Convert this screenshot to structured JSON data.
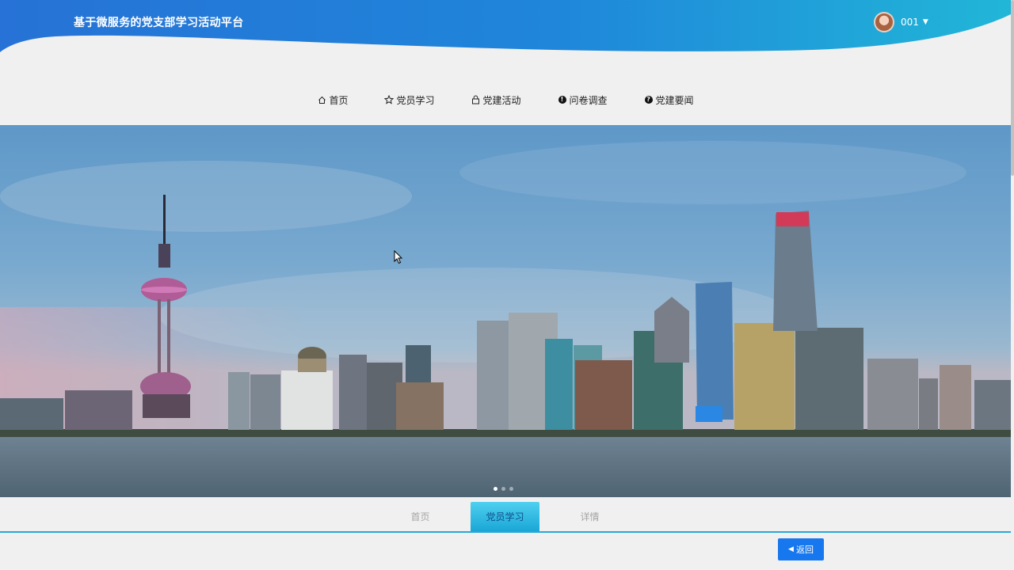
{
  "header": {
    "site_title": "基于微服务的党支部学习活动平台",
    "username": "001",
    "gradient_start": "#2672d6",
    "gradient_end": "#21b6d8"
  },
  "nav": {
    "items": [
      {
        "label": "首页",
        "icon": "home-icon"
      },
      {
        "label": "党员学习",
        "icon": "star-icon"
      },
      {
        "label": "党建活动",
        "icon": "lock-icon"
      },
      {
        "label": "问卷调查",
        "icon": "exclamation-circle-icon"
      },
      {
        "label": "党建要闻",
        "icon": "question-circle-icon"
      }
    ]
  },
  "banner": {
    "slide_count": 3,
    "active_slide": 1
  },
  "tabs": {
    "items": [
      "首页",
      "党员学习",
      "详情"
    ],
    "active_index": 1
  },
  "actions": {
    "back_label": "返回"
  },
  "colors": {
    "primary_button": "#1677ee",
    "tab_active": "#1aa6d6",
    "tab_underline": "#29a8d7"
  }
}
